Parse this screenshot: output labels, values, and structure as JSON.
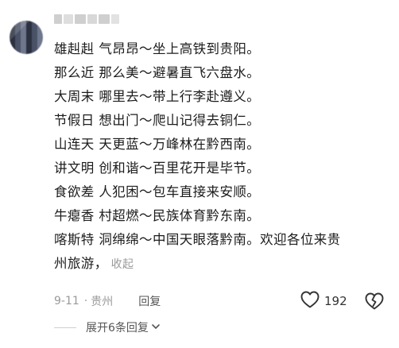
{
  "comment": {
    "lines": [
      "雄赳赳 气昂昂～坐上高铁到贵阳。",
      "那么近 那么美～避暑直飞六盘水。",
      "大周末 哪里去～带上行李赴遵义。",
      "节假日 想出门～爬山记得去铜仁。",
      "山连天 天更蓝～万峰林在黔西南。",
      "讲文明 创和谐～百里花开是毕节。",
      "食欲差 人犯困～包车直接来安顺。",
      "牛瘪香 村超燃～民族体育黔东南。",
      "喀斯特 洞绵绵～中国天眼落黔南。欢迎各位来贵",
      "州旅游，"
    ],
    "collapse_label": "收起"
  },
  "meta": {
    "date": "9-11",
    "separator": "·",
    "location": "贵州",
    "reply_label": "回复"
  },
  "actions": {
    "like_count": "192",
    "like_icon": "heart-outline-icon",
    "dislike_icon": "broken-heart-icon"
  },
  "replies": {
    "expand_label": "展开6条回复",
    "chevron_icon": "chevron-down-icon"
  }
}
